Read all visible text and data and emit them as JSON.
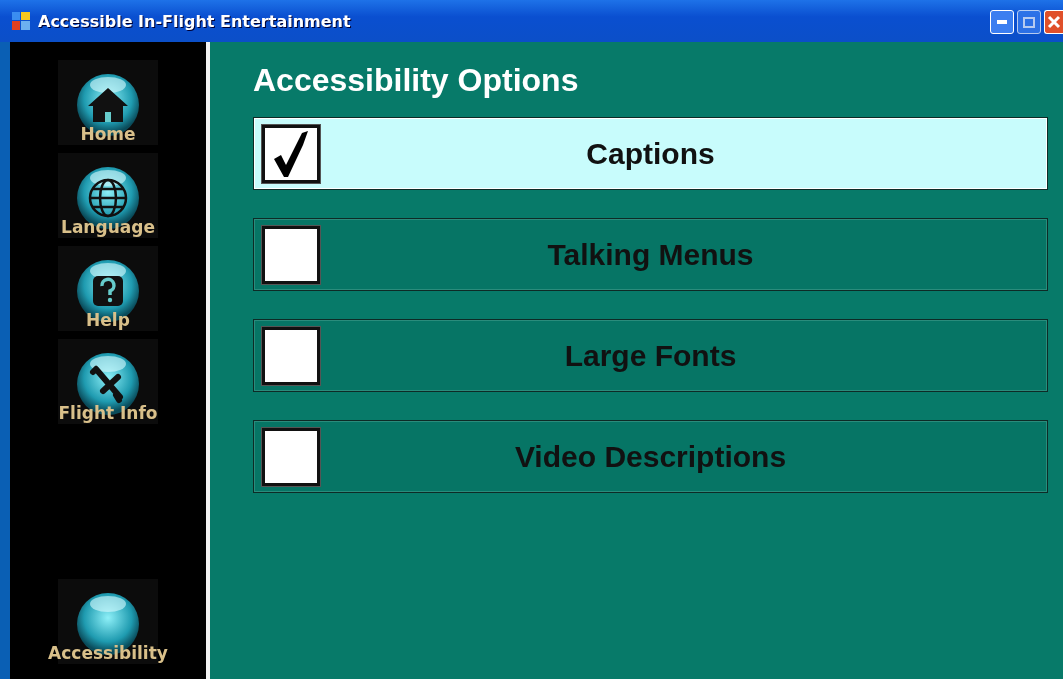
{
  "window": {
    "title": "Accessible In-Flight Entertainment"
  },
  "sidebar": {
    "items": [
      {
        "label": "Home"
      },
      {
        "label": "Language"
      },
      {
        "label": "Help"
      },
      {
        "label": "Flight Info"
      }
    ],
    "bottom_item": {
      "label": "Accessibility"
    }
  },
  "heading": "Accessibility Options",
  "options": [
    {
      "label": "Captions",
      "checked": true
    },
    {
      "label": "Talking Menus",
      "checked": false
    },
    {
      "label": "Large Fonts",
      "checked": false
    },
    {
      "label": "Video Descriptions",
      "checked": false
    }
  ]
}
